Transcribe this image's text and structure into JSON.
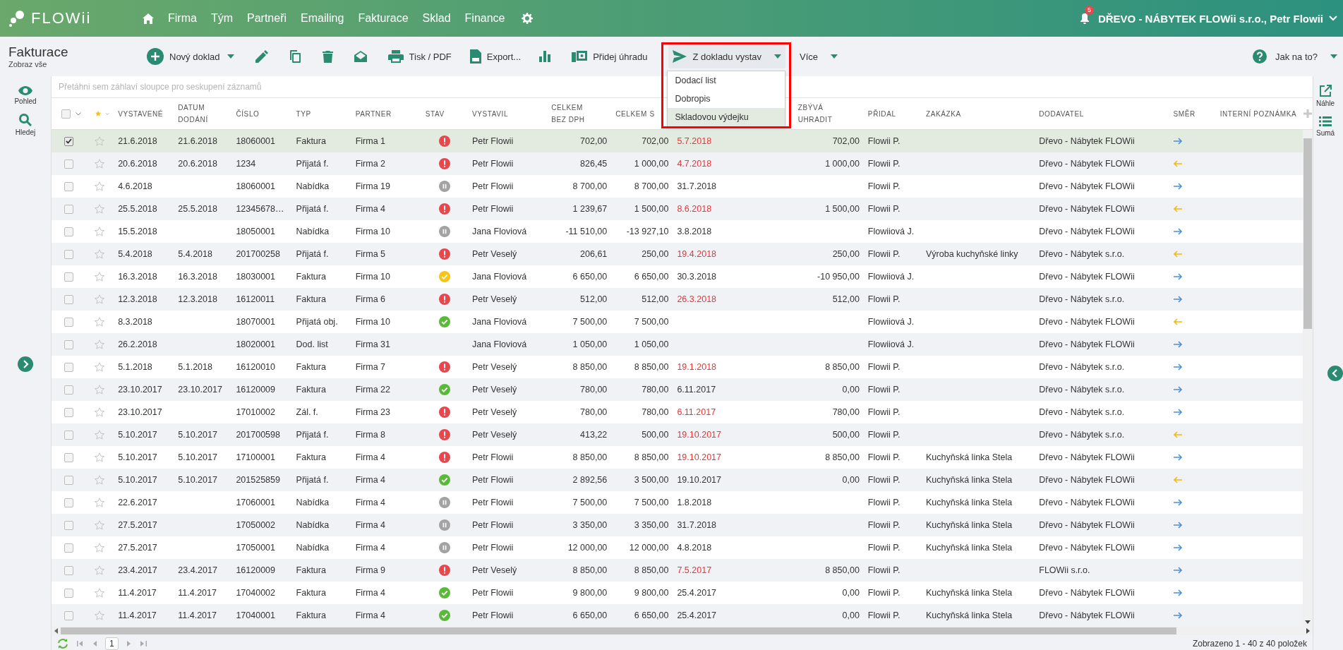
{
  "app": {
    "logo": "FLOWii",
    "nav": [
      "Firma",
      "Tým",
      "Partneři",
      "Emailing",
      "Fakturace",
      "Sklad",
      "Finance"
    ],
    "notifications": "5",
    "account": "DŘEVO - NÁBYTEK FLOWii s.r.o., Petr Flowii"
  },
  "page": {
    "title": "Fakturace",
    "subtitle": "Zobraz vše"
  },
  "toolbar": {
    "new": "Nový doklad",
    "print": "Tisk / PDF",
    "export": "Export...",
    "payment": "Přidej úhradu",
    "issue_from": {
      "label": "Z dokladu vystav",
      "expanded": true,
      "highlighted": true,
      "options": [
        {
          "label": "Dodací list",
          "selected": false
        },
        {
          "label": "Dobropis",
          "selected": false
        },
        {
          "label": "Skladovou výdejku",
          "selected": true
        }
      ]
    },
    "more": "Více",
    "help": "Jak na to?"
  },
  "left_sidebar": [
    "Pohled",
    "Hledej"
  ],
  "right_sidebar": [
    "Náhle",
    "Sumá"
  ],
  "group_hint": "Přetáhni sem záhlaví sloupce pro seskupení záznamů",
  "table": {
    "select_all": {
      "checked": false
    },
    "columns": [
      "VYSTAVENÉ",
      "DATUM\nDODÁNÍ",
      "ČÍSLO",
      "TYP",
      "PARTNER",
      "STAV",
      "VYSTAVIL",
      "CELKEM\nBEZ DPH",
      "CELKEM S",
      "ZBÝVÁ\nUHRADIT",
      "PŘIDAL",
      "ZAKÁZKA",
      "DODAVATEL",
      "SMĚR",
      "INTERNÍ POZNÁMKA"
    ],
    "rows": [
      {
        "selected": true,
        "starred": false,
        "issued": "21.6.2018",
        "delivered": "21.6.2018",
        "number": "18060001",
        "type": "Faktura",
        "partner": "Firma 1",
        "status": {
          "kind": "alert"
        },
        "issued_by": "Petr Flowii",
        "net": "702,00",
        "gross": "702,00",
        "due": "5.7.2018",
        "overdue": true,
        "remaining": "702,00",
        "added_by": "Flowii P.",
        "supplier": "Dřevo - Nábytek FLOWii",
        "direction": {
          "kind": "out"
        }
      },
      {
        "selected": false,
        "starred": false,
        "issued": "20.6.2018",
        "delivered": "20.6.2018",
        "number": "1234",
        "type": "Přijatá f.",
        "partner": "Firma 2",
        "status": {
          "kind": "alert"
        },
        "issued_by": "Petr Flowii",
        "net": "826,45",
        "gross": "1 000,00",
        "due": "4.7.2018",
        "overdue": true,
        "remaining": "1 000,00",
        "added_by": "Flowii P.",
        "supplier": "Dřevo - Nábytek FLOWii",
        "direction": {
          "kind": "in"
        }
      },
      {
        "selected": false,
        "starred": false,
        "issued": "4.6.2018",
        "number": "18060001",
        "type": "Nabídka",
        "partner": "Firma 19",
        "status": {
          "kind": "paused"
        },
        "issued_by": "Petr Flowii",
        "net": "8 700,00",
        "gross": "8 700,00",
        "due": "31.7.2018",
        "overdue": false,
        "added_by": "Flowii P.",
        "supplier": "Dřevo - Nábytek FLOWii",
        "direction": {
          "kind": "out"
        }
      },
      {
        "selected": false,
        "starred": false,
        "issued": "25.5.2018",
        "delivered": "25.5.2018",
        "number": "12345678…",
        "type": "Přijatá f.",
        "partner": "Firma 4",
        "status": {
          "kind": "alert"
        },
        "issued_by": "Petr Flowii",
        "net": "1 239,67",
        "gross": "1 500,00",
        "due": "8.6.2018",
        "overdue": true,
        "remaining": "1 500,00",
        "added_by": "Flowii P.",
        "supplier": "Dřevo - Nábytek FLOWii",
        "direction": {
          "kind": "in"
        }
      },
      {
        "selected": false,
        "starred": false,
        "issued": "15.5.2018",
        "number": "18050001",
        "type": "Nabídka",
        "partner": "Firma 10",
        "status": {
          "kind": "paused"
        },
        "issued_by": "Jana Floviová",
        "net": "-11 510,00",
        "gross": "-13 927,10",
        "due": "3.8.2018",
        "overdue": false,
        "added_by": "Flowiiová J.",
        "supplier": "Dřevo - Nábytek FLOWii",
        "direction": {
          "kind": "out"
        }
      },
      {
        "selected": false,
        "starred": false,
        "issued": "5.4.2018",
        "delivered": "5.4.2018",
        "number": "201700258",
        "type": "Přijatá f.",
        "partner": "Firma 5",
        "status": {
          "kind": "alert"
        },
        "issued_by": "Petr Veselý",
        "net": "206,61",
        "gross": "250,00",
        "due": "19.4.2018",
        "overdue": true,
        "remaining": "250,00",
        "added_by": "Flowii P.",
        "job": "Výroba kuchyňské linky",
        "supplier": "Dřevo - Nábytek s.r.o.",
        "direction": {
          "kind": "in"
        }
      },
      {
        "selected": false,
        "starred": false,
        "issued": "16.3.2018",
        "delivered": "16.3.2018",
        "number": "18030001",
        "type": "Faktura",
        "partner": "Firma 10",
        "status": {
          "kind": "partial"
        },
        "issued_by": "Jana Floviová",
        "net": "6 650,00",
        "gross": "6 650,00",
        "due": "30.3.2018",
        "overdue": false,
        "remaining": "-10 950,00",
        "added_by": "Flowiiová J.",
        "supplier": "Dřevo - Nábytek FLOWii",
        "direction": {
          "kind": "out"
        }
      },
      {
        "selected": false,
        "starred": false,
        "issued": "12.3.2018",
        "delivered": "12.3.2018",
        "number": "16120011",
        "type": "Faktura",
        "partner": "Firma 6",
        "status": {
          "kind": "alert"
        },
        "issued_by": "Petr Veselý",
        "net": "512,00",
        "gross": "512,00",
        "due": "26.3.2018",
        "overdue": true,
        "remaining": "512,00",
        "added_by": "Flowii P.",
        "supplier": "Dřevo - Nábytek s.r.o.",
        "direction": {
          "kind": "out"
        }
      },
      {
        "selected": false,
        "starred": false,
        "issued": "8.3.2018",
        "number": "18070001",
        "type": "Přijatá obj.",
        "partner": "Firma 10",
        "status": {
          "kind": "done"
        },
        "issued_by": "Jana Floviová",
        "net": "7 500,00",
        "gross": "7 500,00",
        "added_by": "Flowiiová J.",
        "supplier": "Dřevo - Nábytek FLOWii",
        "direction": {
          "kind": "in"
        }
      },
      {
        "selected": false,
        "starred": false,
        "issued": "26.2.2018",
        "number": "18020001",
        "type": "Dod. list",
        "partner": "Firma 31",
        "issued_by": "Jana Floviová",
        "net": "1 050,00",
        "gross": "1 050,00",
        "added_by": "Flowiiová J.",
        "supplier": "Dřevo - Nábytek FLOWii",
        "direction": {
          "kind": "out"
        }
      },
      {
        "selected": false,
        "starred": false,
        "issued": "5.1.2018",
        "delivered": "5.1.2018",
        "number": "16120010",
        "type": "Faktura",
        "partner": "Firma 7",
        "status": {
          "kind": "alert"
        },
        "issued_by": "Petr Veselý",
        "net": "8 850,00",
        "gross": "8 850,00",
        "due": "19.1.2018",
        "overdue": true,
        "remaining": "8 850,00",
        "added_by": "Flowii P.",
        "supplier": "Dřevo - Nábytek s.r.o.",
        "direction": {
          "kind": "out"
        }
      },
      {
        "selected": false,
        "starred": false,
        "issued": "23.10.2017",
        "delivered": "23.10.2017",
        "number": "16120009",
        "type": "Faktura",
        "partner": "Firma 22",
        "status": {
          "kind": "done"
        },
        "issued_by": "Petr Veselý",
        "net": "780,00",
        "gross": "780,00",
        "due": "6.11.2017",
        "overdue": false,
        "remaining": "0,00",
        "added_by": "Flowii P.",
        "supplier": "Dřevo - Nábytek s.r.o.",
        "direction": {
          "kind": "out"
        }
      },
      {
        "selected": false,
        "starred": false,
        "issued": "23.10.2017",
        "number": "17010002",
        "type": "Zál. f.",
        "partner": "Firma 23",
        "status": {
          "kind": "alert"
        },
        "issued_by": "Petr Veselý",
        "net": "780,00",
        "gross": "780,00",
        "due": "6.11.2017",
        "overdue": true,
        "remaining": "780,00",
        "added_by": "Flowii P.",
        "supplier": "Dřevo - Nábytek s.r.o.",
        "direction": {
          "kind": "out"
        }
      },
      {
        "selected": false,
        "starred": false,
        "issued": "5.10.2017",
        "delivered": "5.10.2017",
        "number": "201700598",
        "type": "Přijatá f.",
        "partner": "Firma 8",
        "status": {
          "kind": "alert"
        },
        "issued_by": "Petr Veselý",
        "net": "413,22",
        "gross": "500,00",
        "due": "19.10.2017",
        "overdue": true,
        "remaining": "500,00",
        "added_by": "Flowii P.",
        "supplier": "Dřevo - Nábytek s.r.o.",
        "direction": {
          "kind": "in"
        }
      },
      {
        "selected": false,
        "starred": false,
        "issued": "5.10.2017",
        "delivered": "5.10.2017",
        "number": "17100001",
        "type": "Faktura",
        "partner": "Firma 4",
        "status": {
          "kind": "alert"
        },
        "issued_by": "Petr Flowii",
        "net": "8 850,00",
        "gross": "8 850,00",
        "due": "19.10.2017",
        "overdue": true,
        "remaining": "8 850,00",
        "added_by": "Flowii P.",
        "job": "Kuchyňská linka Stela",
        "supplier": "Dřevo - Nábytek FLOWii",
        "direction": {
          "kind": "out"
        }
      },
      {
        "selected": false,
        "starred": false,
        "issued": "5.10.2017",
        "delivered": "5.10.2017",
        "number": "201525859",
        "type": "Přijatá f.",
        "partner": "Firma 4",
        "status": {
          "kind": "done"
        },
        "issued_by": "Petr Flowii",
        "net": "2 892,56",
        "gross": "3 500,00",
        "due": "19.10.2017",
        "overdue": false,
        "remaining": "0,00",
        "added_by": "Flowii P.",
        "job": "Kuchyňská linka Stela",
        "supplier": "Dřevo - Nábytek FLOWii",
        "direction": {
          "kind": "in"
        }
      },
      {
        "selected": false,
        "starred": false,
        "issued": "22.6.2017",
        "number": "17060001",
        "type": "Nabídka",
        "partner": "Firma 4",
        "status": {
          "kind": "paused"
        },
        "issued_by": "Petr Flowii",
        "net": "7 500,00",
        "gross": "7 500,00",
        "due": "1.8.2018",
        "overdue": false,
        "added_by": "Flowii P.",
        "job": "Kuchyňská linka Stela",
        "supplier": "Dřevo - Nábytek FLOWii",
        "direction": {
          "kind": "out"
        }
      },
      {
        "selected": false,
        "starred": false,
        "issued": "27.5.2017",
        "number": "17050002",
        "type": "Nabídka",
        "partner": "Firma 4",
        "status": {
          "kind": "paused"
        },
        "issued_by": "Petr Flowii",
        "net": "3 350,00",
        "gross": "3 350,00",
        "due": "31.7.2018",
        "overdue": false,
        "added_by": "Flowii P.",
        "job": "Kuchyňská linka Stela",
        "supplier": "Dřevo - Nábytek FLOWii",
        "direction": {
          "kind": "out"
        }
      },
      {
        "selected": false,
        "starred": false,
        "issued": "27.5.2017",
        "number": "17050001",
        "type": "Nabídka",
        "partner": "Firma 4",
        "status": {
          "kind": "paused"
        },
        "issued_by": "Petr Flowii",
        "net": "12 000,00",
        "gross": "12 000,00",
        "due": "4.8.2018",
        "overdue": false,
        "added_by": "Flowii P.",
        "job": "Kuchyňská linka Stela",
        "supplier": "Dřevo - Nábytek FLOWii",
        "direction": {
          "kind": "out"
        }
      },
      {
        "selected": false,
        "starred": false,
        "issued": "23.4.2017",
        "delivered": "23.4.2017",
        "number": "16120009",
        "type": "Faktura",
        "partner": "Firma 9",
        "status": {
          "kind": "alert"
        },
        "issued_by": "Petr Veselý",
        "net": "8 850,00",
        "gross": "8 850,00",
        "due": "7.5.2017",
        "overdue": true,
        "remaining": "8 850,00",
        "added_by": "Flowii P.",
        "supplier": "FLOWii s.r.o.",
        "direction": {
          "kind": "out"
        }
      },
      {
        "selected": false,
        "starred": false,
        "issued": "11.4.2017",
        "delivered": "11.4.2017",
        "number": "17040002",
        "type": "Faktura",
        "partner": "Firma 4",
        "status": {
          "kind": "done"
        },
        "issued_by": "Petr Flowii",
        "net": "9 800,00",
        "gross": "9 800,00",
        "due": "25.4.2017",
        "overdue": false,
        "remaining": "0,00",
        "added_by": "Flowii P.",
        "job": "Kuchyňská linka Stela",
        "supplier": "Dřevo - Nábytek FLOWii",
        "direction": {
          "kind": "out"
        }
      },
      {
        "selected": false,
        "starred": false,
        "issued": "11.4.2017",
        "delivered": "11.4.2017",
        "number": "17040001",
        "type": "Faktura",
        "partner": "Firma 4",
        "status": {
          "kind": "done"
        },
        "issued_by": "Petr Flowii",
        "net": "6 650,00",
        "gross": "6 650,00",
        "due": "25.4.2017",
        "overdue": false,
        "remaining": "0,00",
        "added_by": "Flowii P.",
        "job": "Kuchyňská linka Stela",
        "supplier": "Dřevo - Nábytek FLOWii",
        "direction": {
          "kind": "out"
        }
      }
    ]
  },
  "pager": {
    "page": "1",
    "summary": "Zobrazeno 1 - 40 z 40 položek"
  }
}
